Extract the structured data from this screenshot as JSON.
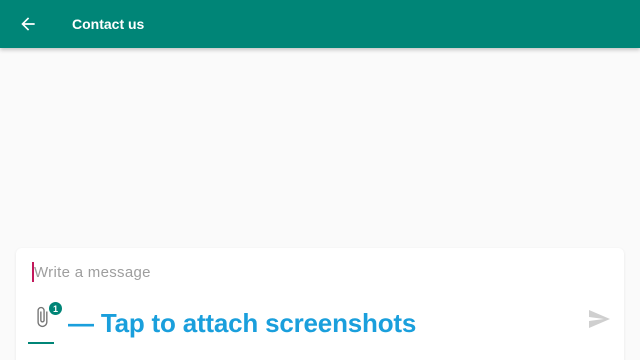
{
  "app_bar": {
    "title": "Contact us",
    "back_icon": "arrow-back-icon",
    "color": "#008577"
  },
  "composer": {
    "placeholder": "Write a message",
    "value": "",
    "attach_icon": "paperclip-icon",
    "attachment_count": "1",
    "send_icon": "send-icon"
  },
  "annotation": {
    "text": "— Tap to attach screenshots",
    "color": "#1a9fdc"
  }
}
